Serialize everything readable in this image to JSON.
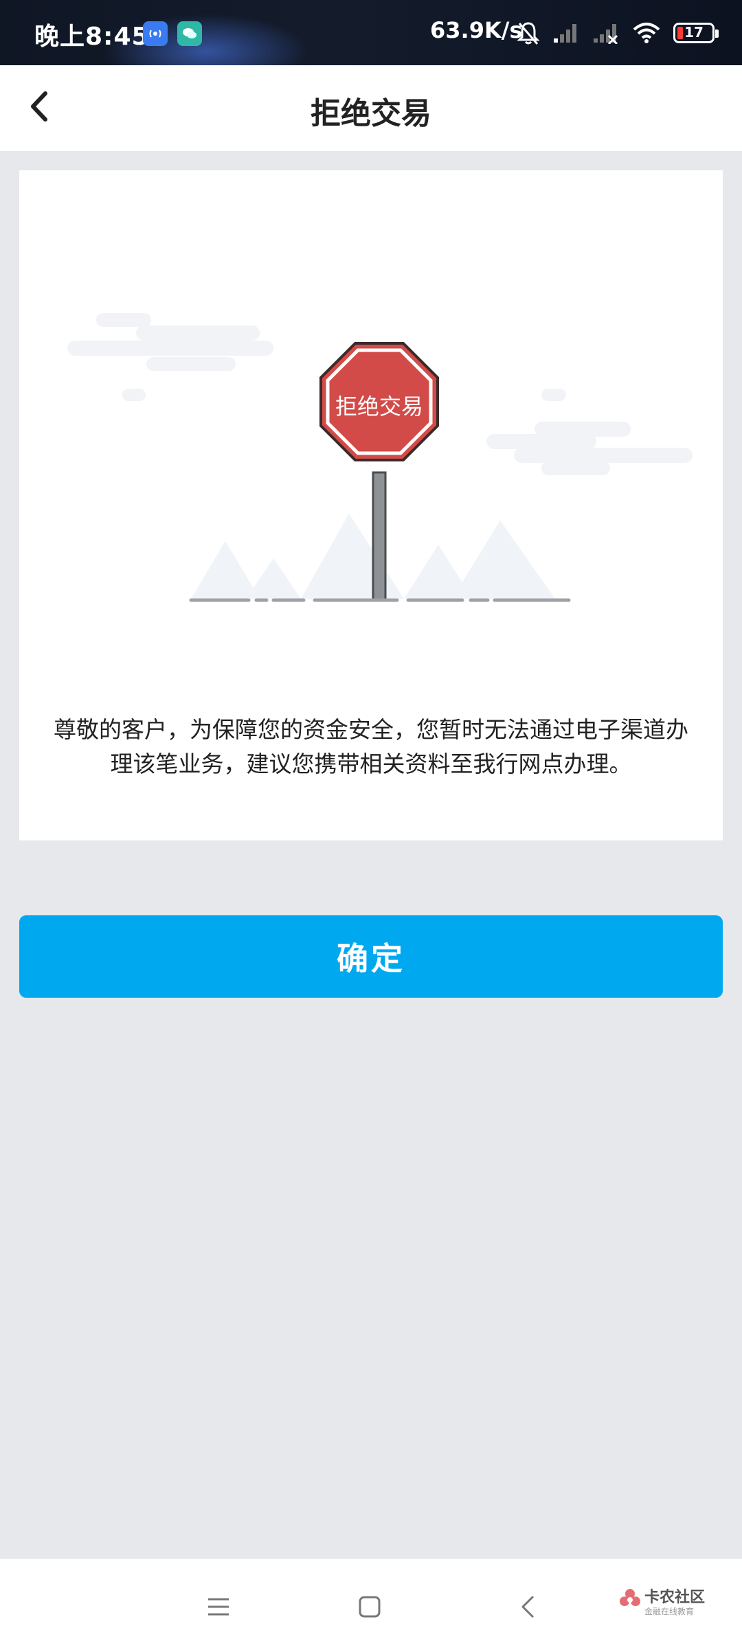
{
  "status_bar": {
    "time": "晚上8:45",
    "net_speed": "63.9K/s",
    "battery_level": "17",
    "battery_fraction": 0.17
  },
  "header": {
    "title": "拒绝交易",
    "back_icon": "chevron-left-icon"
  },
  "illustration": {
    "sign_text": "拒绝交易",
    "sign_color": "#d24b48"
  },
  "message": "尊敬的客户，为保障您的资金安全，您暂时无法通过电子渠道办理该笔业务，建议您携带相关资料至我行网点办理。",
  "confirm_button": {
    "label": "确定",
    "color": "#00a9ef"
  },
  "watermark": {
    "text": "卡农社区",
    "sub": "金融在线教育"
  }
}
